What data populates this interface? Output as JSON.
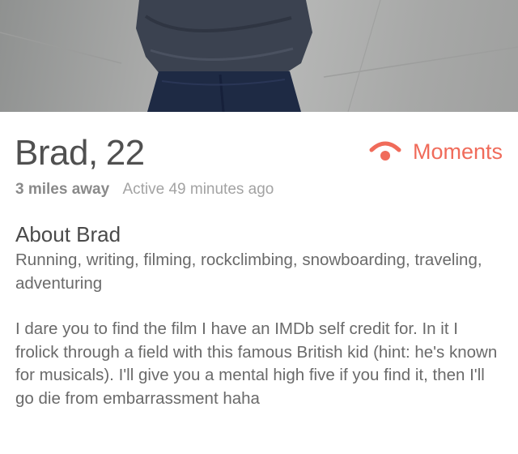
{
  "profile": {
    "name": "Brad",
    "separator": ",",
    "age": "22",
    "distance": "3 miles away",
    "active": "Active 49 minutes ago"
  },
  "moments": {
    "label": "Moments",
    "icon": "wifi-signal-icon",
    "color": "#f06b5a"
  },
  "about": {
    "title": "About Brad",
    "interests": "Running, writing, filming, rockclimbing, snowboarding, traveling, adventuring",
    "bio": "I dare you to find the film I have an IMDb self credit for. In it I frolick through a field with this famous British kid (hint: he's known for musicals). I'll give you a mental high five if you find it, then I'll go die from embarrassment haha"
  }
}
